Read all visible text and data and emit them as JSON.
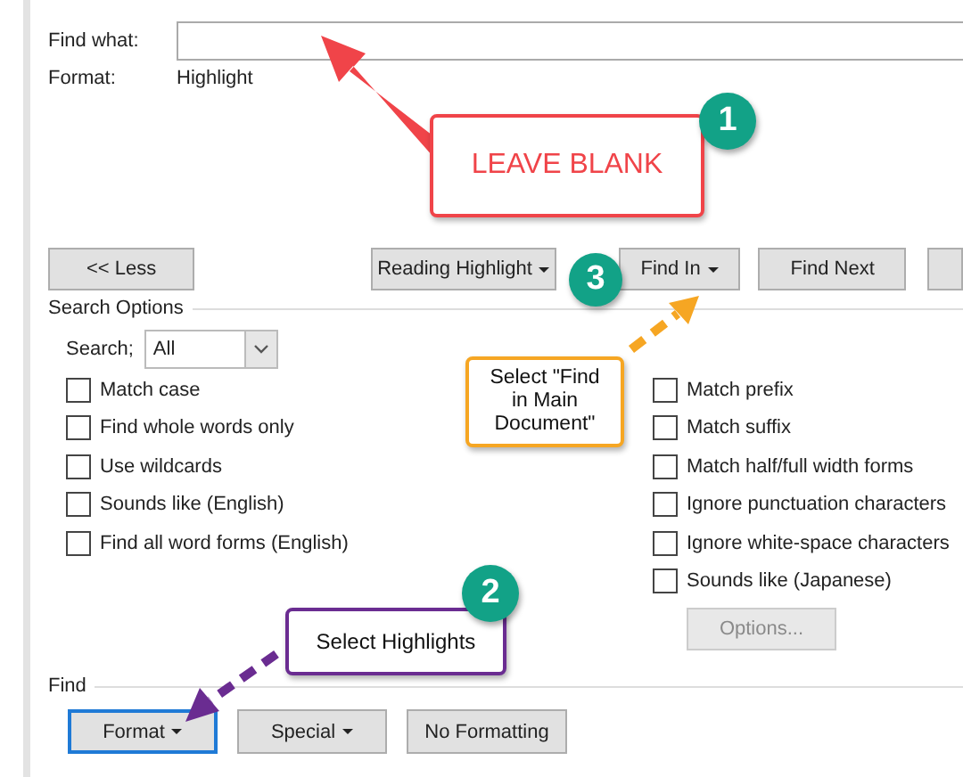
{
  "find_what": {
    "label": "Find what:"
  },
  "format": {
    "label": "Format:",
    "value": "Highlight"
  },
  "action_buttons": [
    {
      "label": "<< Less",
      "dropdown": false
    },
    {
      "label": "Reading Highlight",
      "dropdown": true
    },
    {
      "label": "Find In",
      "dropdown": true
    },
    {
      "label": "Find Next",
      "dropdown": false
    }
  ],
  "search_options": {
    "title": "Search Options",
    "search_label": "Search;",
    "search_value": "All",
    "left_options": [
      {
        "label": "Match case",
        "checked": false
      },
      {
        "label": "Find whole words only",
        "checked": false
      },
      {
        "label": "Use wildcards",
        "checked": false
      },
      {
        "label": "Sounds like (English)",
        "checked": false
      },
      {
        "label": "Find all word forms (English)",
        "checked": false
      }
    ],
    "right_options": [
      {
        "label": "Match prefix",
        "checked": false
      },
      {
        "label": "Match suffix",
        "checked": false
      },
      {
        "label": "Match half/full width forms",
        "checked": false
      },
      {
        "label": "Ignore punctuation characters",
        "checked": false
      },
      {
        "label": "Ignore white-space characters",
        "checked": false
      },
      {
        "label": "Sounds like (Japanese)",
        "checked": false
      }
    ],
    "options_button": {
      "label": "Options...",
      "disabled": true
    }
  },
  "find_group": {
    "title": "Find",
    "buttons": [
      {
        "label": "Format",
        "dropdown": true,
        "selected": true
      },
      {
        "label": "Special",
        "dropdown": true,
        "selected": false
      },
      {
        "label": "No Formatting",
        "dropdown": false,
        "selected": false
      }
    ]
  },
  "annotations": [
    {
      "badge": "1",
      "text": "LEAVE BLANK",
      "color": "#f04449"
    },
    {
      "badge": "3",
      "text": "Select \"Find in Main Document\"",
      "color": "#f6a623"
    },
    {
      "badge": "2",
      "text": "Select Highlights",
      "color": "#6a2c91"
    }
  ]
}
